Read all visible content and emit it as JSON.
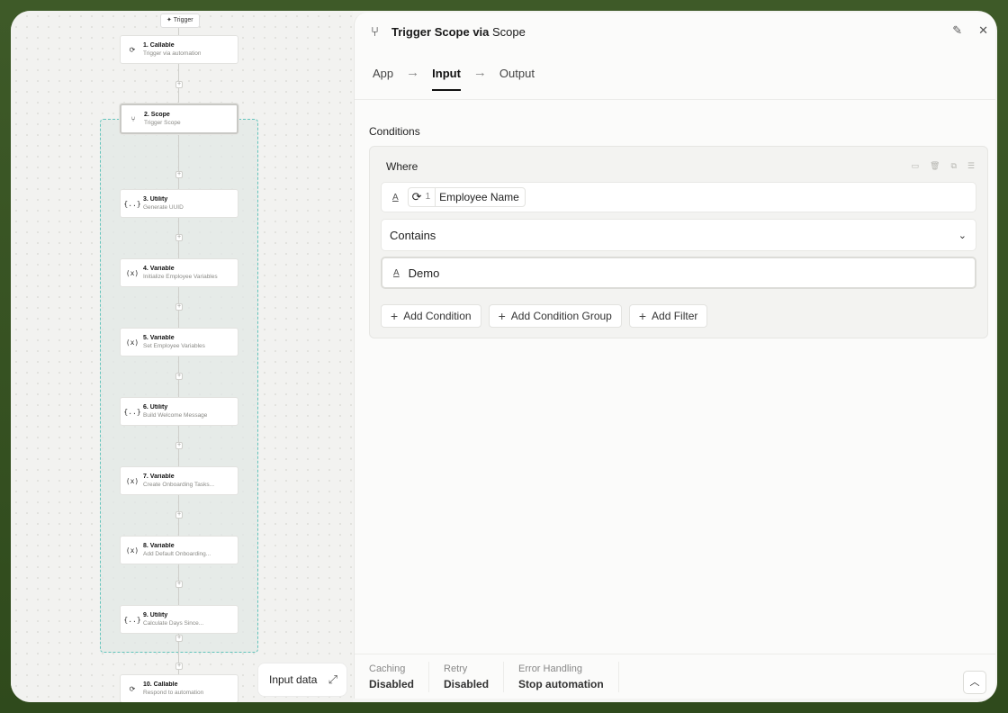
{
  "canvas": {
    "trigger_label": "Trigger",
    "trigger_icon": "sparkle-icon",
    "nodes": [
      {
        "title": "1. Callable",
        "subtitle": "Trigger via automation",
        "icon": "refresh-icon"
      },
      {
        "title": "2. Scope",
        "subtitle": "Trigger Scope",
        "icon": "branch-icon"
      },
      {
        "title": "3. Utility",
        "subtitle": "Generate UUID",
        "icon": "braces-icon"
      },
      {
        "title": "4. Variable",
        "subtitle": "Initialize Employee Variables",
        "icon": "variable-icon"
      },
      {
        "title": "5. Variable",
        "subtitle": "Set Employee Variables",
        "icon": "variable-icon"
      },
      {
        "title": "6. Utility",
        "subtitle": "Build Welcome Message",
        "icon": "braces-icon"
      },
      {
        "title": "7. Variable",
        "subtitle": "Create Onboarding Tasks...",
        "icon": "variable-icon"
      },
      {
        "title": "8. Variable",
        "subtitle": "Add Default Onboarding...",
        "icon": "variable-icon"
      },
      {
        "title": "9. Utility",
        "subtitle": "Calculate Days Since...",
        "icon": "braces-icon"
      },
      {
        "title": "10. Callable",
        "subtitle": "Respond to automation",
        "icon": "refresh-icon"
      }
    ],
    "input_data_label": "Input data"
  },
  "panel": {
    "title_main": "Trigger Scope via",
    "title_sub": "Scope",
    "tabs": [
      {
        "label": "App"
      },
      {
        "label": "Input"
      },
      {
        "label": "Output"
      }
    ],
    "active_tab": "Input",
    "section_label": "Conditions",
    "where_label": "Where",
    "field_chip": {
      "step_number": "1",
      "label": "Employee Name"
    },
    "operator_value": "Contains",
    "condition_value": "Demo",
    "actions": {
      "add_condition": "Add Condition",
      "add_condition_group": "Add Condition Group",
      "add_filter": "Add Filter"
    },
    "footer": [
      {
        "label": "Caching",
        "value": "Disabled"
      },
      {
        "label": "Retry",
        "value": "Disabled"
      },
      {
        "label": "Error Handling",
        "value": "Stop automation"
      }
    ]
  }
}
